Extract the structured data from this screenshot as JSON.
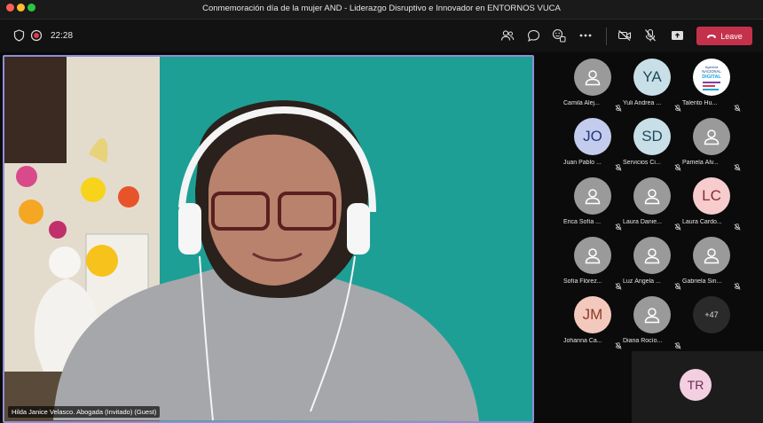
{
  "window": {
    "title": "Conmemoración día de la mujer AND - Liderazgo Disruptivo e Innovador en ENTORNOS VUCA"
  },
  "toolbar": {
    "timer": "22:28",
    "leave_label": "Leave"
  },
  "stage": {
    "speaker_name": "Hilda Janice Velasco. Abogada (Invitado) (Guest)"
  },
  "participants": [
    {
      "name": "Camila Alej...",
      "initials": "",
      "style": "grey"
    },
    {
      "name": "Yuli Andrea ...",
      "initials": "YA",
      "style": "ice"
    },
    {
      "name": "Talento Hu...",
      "initials": "",
      "style": "logo"
    },
    {
      "name": "Juan Pablo ...",
      "initials": "JO",
      "style": "blue"
    },
    {
      "name": "Servicios Ci...",
      "initials": "SD",
      "style": "ice"
    },
    {
      "name": "Pamela Álv...",
      "initials": "",
      "style": "grey"
    },
    {
      "name": "Erica Sofía ...",
      "initials": "",
      "style": "grey"
    },
    {
      "name": "Laura Danie...",
      "initials": "",
      "style": "grey"
    },
    {
      "name": "Laura Cardo...",
      "initials": "LC",
      "style": "pink"
    },
    {
      "name": "Sofía Flórez...",
      "initials": "",
      "style": "grey"
    },
    {
      "name": "Luz Ángela ...",
      "initials": "",
      "style": "grey"
    },
    {
      "name": "Gabriela Sin...",
      "initials": "",
      "style": "grey"
    },
    {
      "name": "Johanna Ca...",
      "initials": "JM",
      "style": "peach"
    },
    {
      "name": "Diana Rocío...",
      "initials": "",
      "style": "grey"
    },
    {
      "name": "",
      "initials": "+47",
      "style": "more"
    }
  ],
  "logo_text": "Agencia NACIONAL DIGITAL",
  "self_view": {
    "initials": "TR"
  }
}
